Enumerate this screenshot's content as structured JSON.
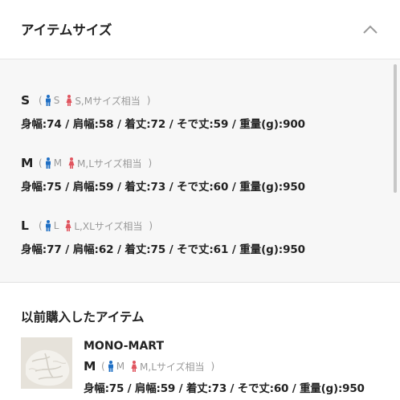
{
  "header": {
    "title": "アイテムサイズ"
  },
  "sizes": [
    {
      "letter": "S",
      "men": "S",
      "women": "S,Mサイズ相当",
      "measurements": "身幅:74 / 肩幅:58 / 着丈:72 / そで丈:59 / 重量(g):900"
    },
    {
      "letter": "M",
      "men": "M",
      "women": "M,Lサイズ相当",
      "measurements": "身幅:75 / 肩幅:59 / 着丈:73 / そで丈:60 / 重量(g):950"
    },
    {
      "letter": "L",
      "men": "L",
      "women": "L,XLサイズ相当",
      "measurements": "身幅:77 / 肩幅:62 / 着丈:75 / そで丈:61 / 重量(g):950"
    }
  ],
  "previous": {
    "title": "以前購入したアイテム",
    "brand": "MONO-MART",
    "size": {
      "letter": "M",
      "men": "M",
      "women": "M,Lサイズ相当"
    },
    "measurements": "身幅:75 / 肩幅:59 / 着丈:73 / そで丈:60 / 重量(g):950"
  },
  "colors": {
    "men_icon": "#1f6fc4",
    "women_icon": "#e0555f",
    "muted_text": "#9a9a9a"
  },
  "icons": {
    "collapse": "chevron-up-icon",
    "men": "male-figure-icon",
    "women": "female-figure-icon"
  }
}
